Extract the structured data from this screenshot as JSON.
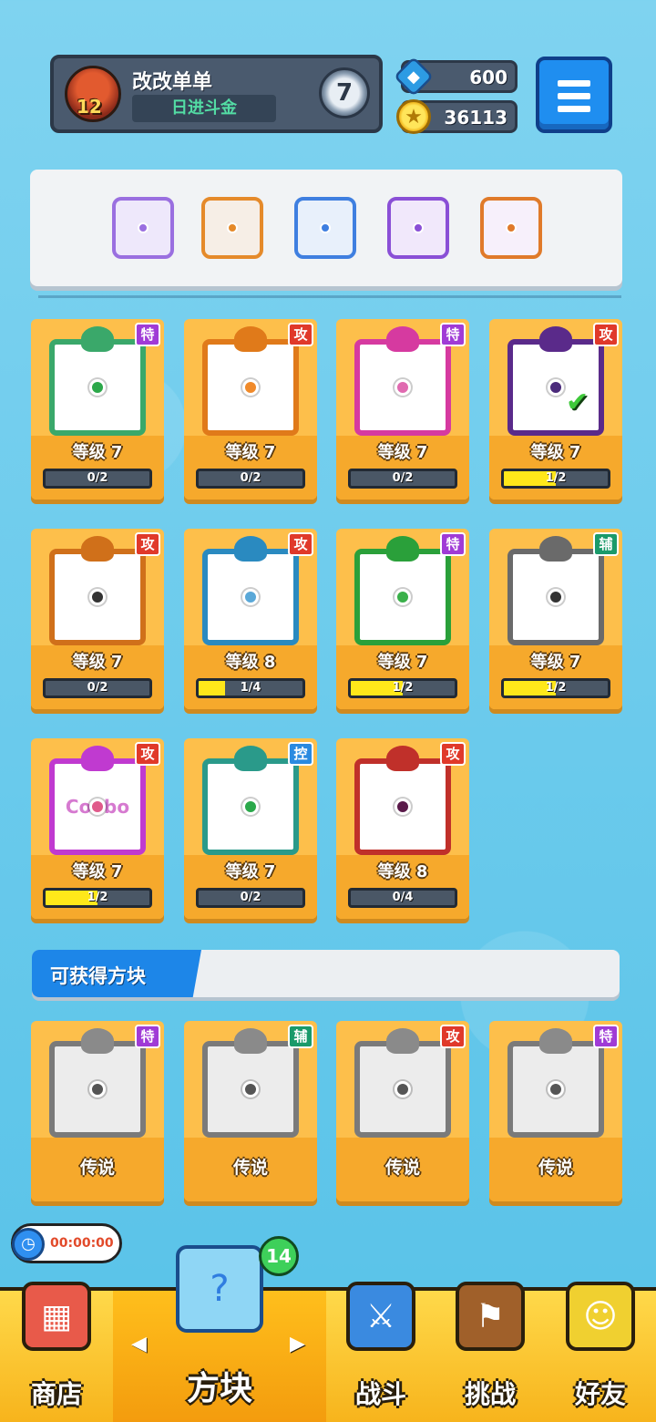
{
  "header": {
    "player_name": "改改单单",
    "player_level": "12",
    "title": "日进斗金",
    "rank": "7",
    "gems": "600",
    "coins": "36113",
    "icons": {
      "gem": "gem-icon",
      "coin": "coin-icon",
      "menu": "hamburger-menu-icon"
    }
  },
  "deck": {
    "slots": [
      {
        "name": "purple-shatter-block",
        "border": "#9a6fe0",
        "fill": "#eee8fb"
      },
      {
        "name": "orange-dot-block",
        "border": "#e58a2a",
        "fill": "#f6eee6"
      },
      {
        "name": "blue-snowflake-block",
        "border": "#3f7fe0",
        "fill": "#e8f0fb"
      },
      {
        "name": "purple-rune-block",
        "border": "#8a4fd6",
        "fill": "#f1e8fb"
      },
      {
        "name": "rainbow-infinity-block",
        "border": "#e07a2a",
        "fill": "#f7f0fb"
      }
    ]
  },
  "owned_blocks": [
    {
      "tag": "特",
      "tag_color": "#a03bd6",
      "frame": "#3aa86a",
      "dot": "#2ca84a",
      "level": "等级 7",
      "progress": "0/2",
      "fill": 0
    },
    {
      "tag": "攻",
      "tag_color": "#e0392a",
      "frame": "#e07a1a",
      "dot": "#f08a2a",
      "level": "等级 7",
      "progress": "0/2",
      "fill": 0
    },
    {
      "tag": "特",
      "tag_color": "#a03bd6",
      "frame": "#d63aa0",
      "dot": "#e06ab0",
      "level": "等级 7",
      "progress": "0/2",
      "fill": 0
    },
    {
      "tag": "攻",
      "tag_color": "#e0392a",
      "frame": "#5a2a8a",
      "dot": "#4a2a7a",
      "level": "等级 7",
      "progress": "1/2",
      "fill": 0.5,
      "equipped": true
    },
    {
      "tag": "攻",
      "tag_color": "#e0392a",
      "frame": "#d0701a",
      "dot": "#333333",
      "level": "等级 7",
      "progress": "0/2",
      "fill": 0
    },
    {
      "tag": "攻",
      "tag_color": "#e0392a",
      "frame": "#2a8ac0",
      "dot": "#5aa8d8",
      "level": "等级 8",
      "progress": "1/4",
      "fill": 0.25
    },
    {
      "tag": "特",
      "tag_color": "#a03bd6",
      "frame": "#2aa03a",
      "dot": "#3ab04a",
      "level": "等级 7",
      "progress": "1/2",
      "fill": 0.5
    },
    {
      "tag": "辅",
      "tag_color": "#1a9a6a",
      "frame": "#6a6a6a",
      "dot": "#333333",
      "level": "等级 7",
      "progress": "1/2",
      "fill": 0.5
    },
    {
      "tag": "攻",
      "tag_color": "#e0392a",
      "frame": "#c03ad0",
      "dot": "#e05a8a",
      "level": "等级 7",
      "progress": "1/2",
      "fill": 0.5,
      "art_text": "Coobo"
    },
    {
      "tag": "控",
      "tag_color": "#2a8ae0",
      "frame": "#2a9a8a",
      "dot": "#2aa84a",
      "level": "等级 7",
      "progress": "0/2",
      "fill": 0
    },
    {
      "tag": "攻",
      "tag_color": "#e0392a",
      "frame": "#c0302a",
      "dot": "#5a1a4a",
      "level": "等级 8",
      "progress": "0/4",
      "fill": 0
    }
  ],
  "obtainable": {
    "title": "可获得方块",
    "blocks": [
      {
        "tag": "特",
        "tag_color": "#a03bd6",
        "rarity": "传说"
      },
      {
        "tag": "辅",
        "tag_color": "#1a9a6a",
        "rarity": "传说"
      },
      {
        "tag": "攻",
        "tag_color": "#e0392a",
        "rarity": "传说"
      },
      {
        "tag": "特",
        "tag_color": "#a03bd6",
        "rarity": "传说"
      }
    ]
  },
  "timer": {
    "text": "00:00:00"
  },
  "nav": {
    "badge": "14",
    "items": [
      {
        "label": "商店",
        "icon": "shop-icon",
        "glyph": "▦"
      },
      {
        "label": "方块",
        "icon": "cube-icon",
        "glyph": "?"
      },
      {
        "label": "战斗",
        "icon": "battle-icon",
        "glyph": "⚔"
      },
      {
        "label": "挑战",
        "icon": "challenge-icon",
        "glyph": "⚑"
      },
      {
        "label": "好友",
        "icon": "friends-icon",
        "glyph": "☺"
      }
    ]
  }
}
